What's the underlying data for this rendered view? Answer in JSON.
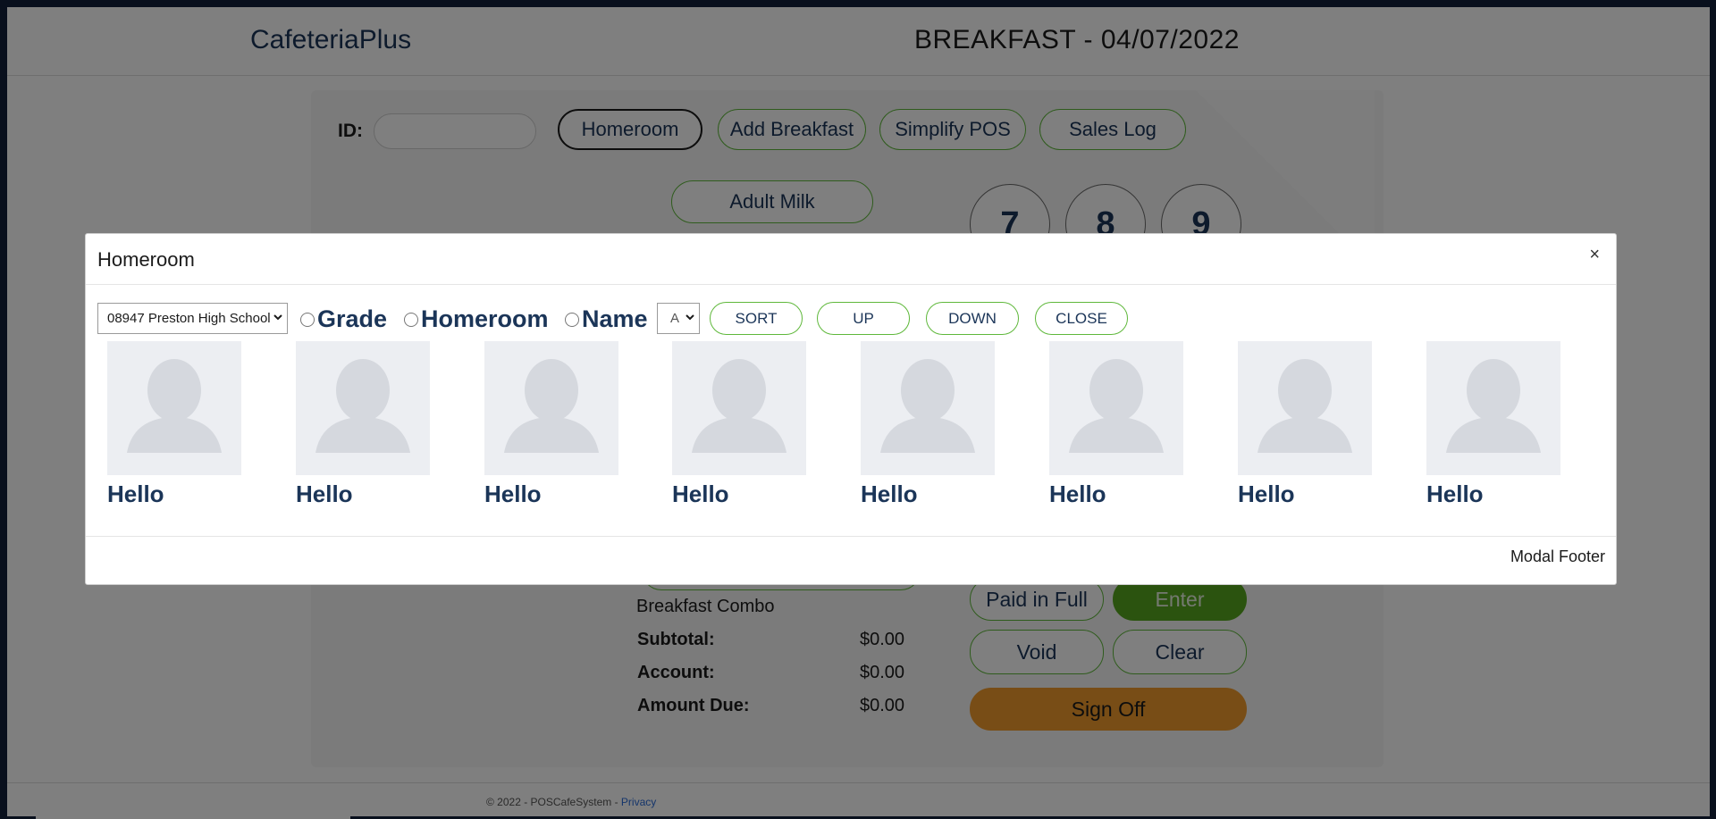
{
  "header": {
    "brand": "CafeteriaPlus",
    "meal_title": "BREAKFAST - 04/07/2022"
  },
  "toolbar": {
    "id_label": "ID:",
    "buttons": [
      "Homeroom",
      "Add Breakfast",
      "Simplify POS",
      "Sales Log"
    ],
    "adult_milk": "Adult Milk"
  },
  "keypad": [
    "7",
    "8",
    "9"
  ],
  "actions": {
    "paid_in_full": "Paid in Full",
    "enter": "Enter",
    "void": "Void",
    "clear": "Clear",
    "sign_off": "Sign Off"
  },
  "summary": {
    "item": "Breakfast Combo",
    "subtotal_label": "Subtotal:",
    "subtotal_value": "$0.00",
    "account_label": "Account:",
    "account_value": "$0.00",
    "due_label": "Amount Due:",
    "due_value": "$0.00"
  },
  "footer": {
    "copyright": "© 2022 - POSCafeSystem - ",
    "privacy": "Privacy"
  },
  "modal": {
    "title": "Homeroom",
    "close": "×",
    "school_select": "08947 Preston High School",
    "sort_options": [
      "Grade",
      "Homeroom",
      "Name"
    ],
    "letter_select": "A",
    "buttons": [
      "SORT",
      "UP",
      "DOWN",
      "CLOSE"
    ],
    "students": [
      "Hello",
      "Hello",
      "Hello",
      "Hello",
      "Hello",
      "Hello",
      "Hello",
      "Hello"
    ],
    "footer_text": "Modal Footer"
  },
  "colors": {
    "brand_navy": "#1b3558",
    "accent_green": "#5fb83b",
    "enter_green": "#56a61f",
    "signoff_orange": "#f19b2d"
  }
}
